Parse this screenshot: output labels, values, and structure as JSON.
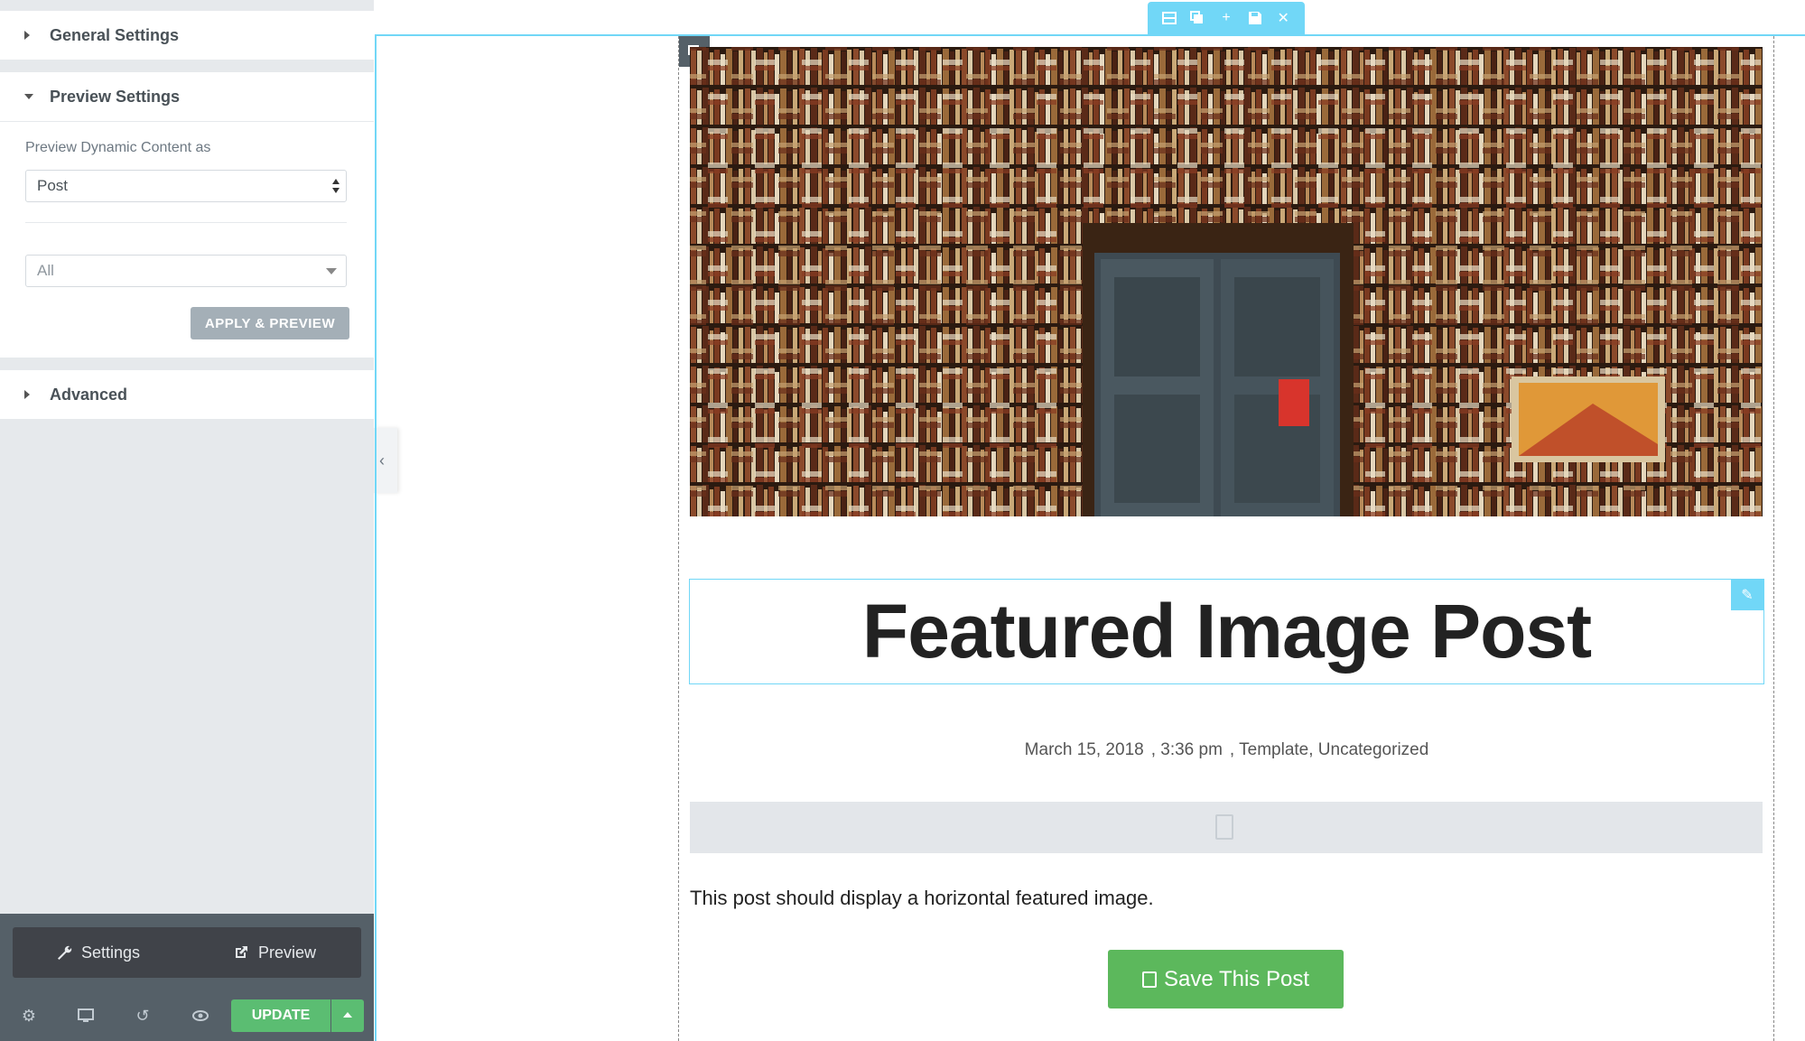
{
  "panel": {
    "sections": [
      {
        "title": "General Settings",
        "expanded": false
      },
      {
        "title": "Preview Settings",
        "expanded": true
      },
      {
        "title": "Advanced",
        "expanded": false
      }
    ],
    "preview": {
      "label": "Preview Dynamic Content as",
      "type_value": "Post",
      "filter_value": "All",
      "apply_label": "APPLY & PREVIEW"
    },
    "footer": {
      "settings_label": "Settings",
      "preview_label": "Preview",
      "update_label": "UPDATE"
    }
  },
  "editor": {
    "accent_color": "#71d7f7",
    "post_title": "Featured Image Post",
    "meta": {
      "date": "March 15, 2018",
      "time": ", 3:36 pm",
      "categories": ", Template, Uncategorized"
    },
    "content": "This post should display a horizontal featured image.",
    "save_button_label": "Save This Post",
    "save_button_color": "#5cb85c"
  }
}
